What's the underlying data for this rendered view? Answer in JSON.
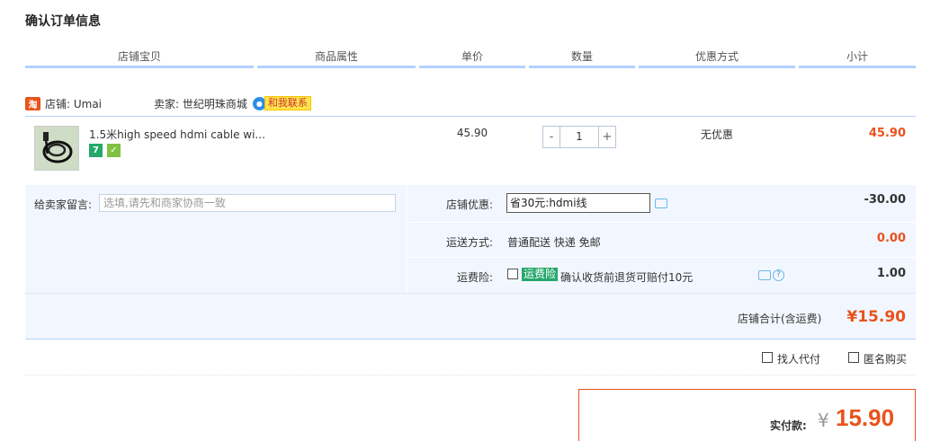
{
  "page_title": "确认订单信息",
  "columns": [
    "店铺宝贝",
    "商品属性",
    "单价",
    "数量",
    "优惠方式",
    "小计"
  ],
  "shop": {
    "icon_text": "淘",
    "shop_label": "店铺: Umai",
    "seller_label": "卖家: 世纪明珠商城",
    "contact_label": "和我联系"
  },
  "item": {
    "title": "1.5米high speed hdmi cable wi...",
    "badge_7": "7",
    "badge_v": "✓",
    "price": "45.90",
    "quantity": "1",
    "qty_minus": "-",
    "qty_plus": "+",
    "promotion": "无优惠",
    "subtotal": "45.90"
  },
  "message": {
    "label": "给卖家留言:",
    "placeholder": "选填,请先和商家协商一致"
  },
  "options": {
    "coupon_label": "店铺优惠:",
    "coupon_value": "省30元:hdmi线",
    "coupon_amount": "-30.00",
    "shipping_label": "运送方式:",
    "shipping_value": "普通配送 快递 免邮",
    "shipping_amount": "0.00",
    "insurance_label": "运费险:",
    "insurance_tag": "运费险",
    "insurance_desc": "确认收货前退货可赔付10元",
    "insurance_amount": "1.00"
  },
  "shop_total": {
    "label": "店铺合计(含运费)",
    "value": "¥15.90"
  },
  "extras": {
    "proxy_pay": "找人代付",
    "anonymous": "匿名购买"
  },
  "payment": {
    "label": "实付款:",
    "currency": "¥",
    "amount": "15.90"
  }
}
